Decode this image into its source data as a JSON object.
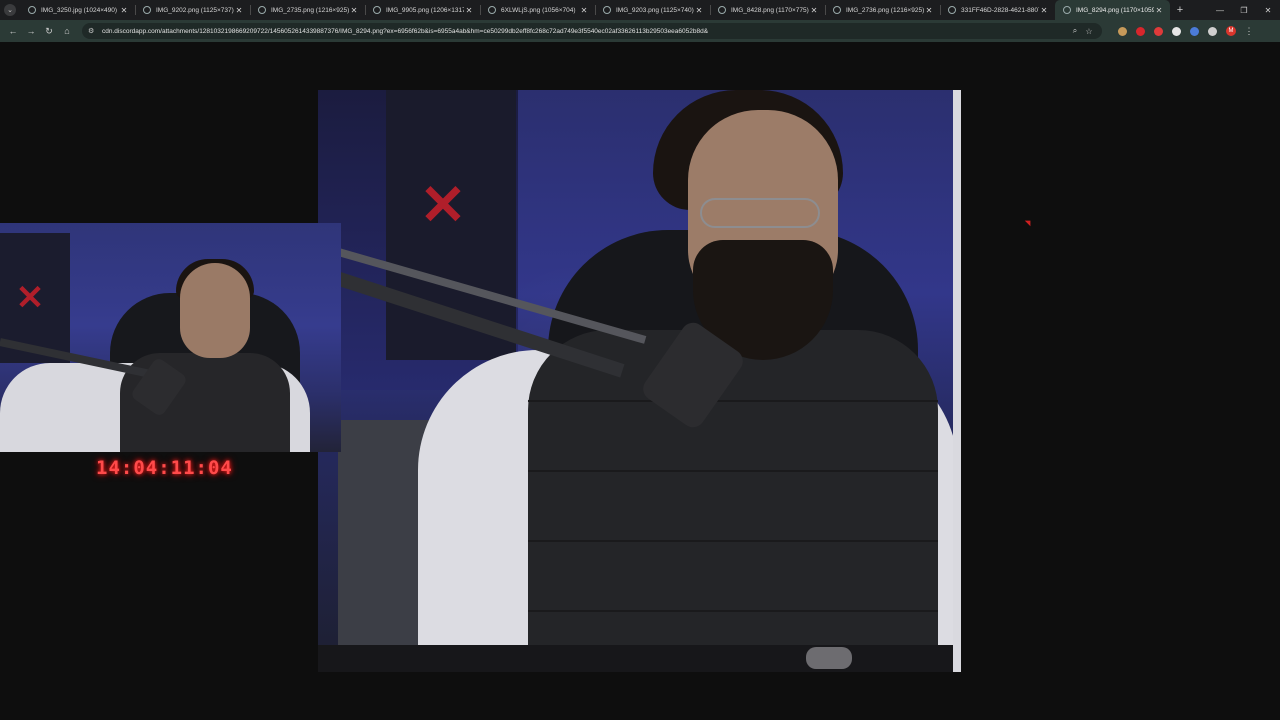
{
  "tabs": [
    {
      "title": "IMG_3250.jpg (1024×490)",
      "active": false
    },
    {
      "title": "IMG_9202.png (1125×737)",
      "active": false
    },
    {
      "title": "IMG_2735.png (1216×925)",
      "active": false
    },
    {
      "title": "IMG_9905.png (1206×1317)",
      "active": false
    },
    {
      "title": "6XLWLjS.png (1056×704)",
      "active": false
    },
    {
      "title": "IMG_9203.png (1125×740)",
      "active": false
    },
    {
      "title": "IMG_8428.png (1170×775)",
      "active": false
    },
    {
      "title": "IMG_2736.png (1216×925)",
      "active": false
    },
    {
      "title": "331FF46D-2828-4621-8807-...",
      "active": false
    },
    {
      "title": "IMG_8294.png (1170×1059)",
      "active": true
    }
  ],
  "toolbar": {
    "url": "cdn.discordapp.com/attachments/1281032198669209722/1456052614339887376/IMG_8294.png?ex=6956f62b&is=6955a4ab&hm=ce50299db2eff8fc268c72ad749e3f5540ec02af33626113b29503eea6052b8d&",
    "profile_initial": "M"
  },
  "extensions": [
    {
      "icon": "cookie-extension-icon",
      "color": "#c79a5a"
    },
    {
      "icon": "shield-extension-icon",
      "color": "#d8262c"
    },
    {
      "icon": "adblock-extension-icon",
      "color": "#e03a3a"
    },
    {
      "icon": "diamond-extension-icon",
      "color": "#e6e6e6"
    },
    {
      "icon": "translate-extension-icon",
      "color": "#4b7bd8"
    },
    {
      "icon": "puzzle-extension-icon",
      "color": "#cfcfcf"
    }
  ],
  "overlay": {
    "timer": "14:04:11:04"
  },
  "colors": {
    "tab_strip": "#1c1d1f",
    "toolbar": "#2b3a36",
    "viewer_background": "#0e0e0e",
    "timer": "#ff4a4a"
  }
}
